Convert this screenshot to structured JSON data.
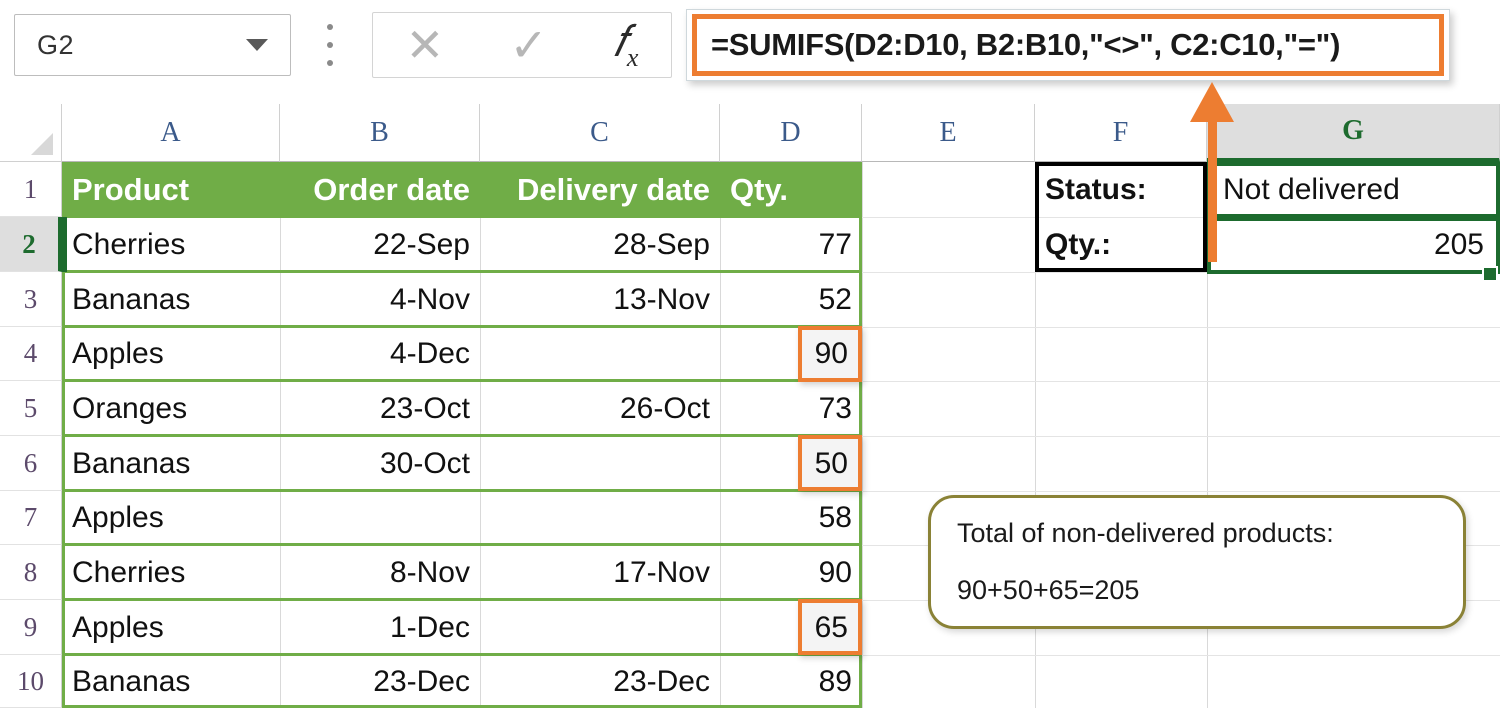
{
  "formula_bar": {
    "name_box_value": "G2",
    "name_box_chevron_icon": "chevron-down-icon",
    "cancel_icon": "close-x-icon",
    "confirm_icon": "check-icon",
    "function_icon": "fx-insert-function-icon",
    "more_icon": "vertical-dots-icon",
    "formula": "=SUMIFS(D2:D10, B2:B10,\"<>\", C2:C10,\"=\")",
    "highlight_color": "#ED7D31"
  },
  "grid": {
    "column_headers": [
      "A",
      "B",
      "C",
      "D",
      "E",
      "F",
      "G"
    ],
    "selected_column": "G",
    "row_headers": [
      "1",
      "2",
      "3",
      "4",
      "5",
      "6",
      "7",
      "8",
      "9",
      "10"
    ],
    "selected_row": "2",
    "table_header": {
      "fill_color": "#70AD47",
      "text_color": "#FFFFFF",
      "cells": [
        "Product",
        "Order date",
        "Delivery date",
        "Qty."
      ]
    },
    "rows": [
      {
        "row": "2",
        "product": "Cherries",
        "order_date": "22-Sep",
        "delivery_date": "28-Sep",
        "qty": "77",
        "qty_highlighted": false
      },
      {
        "row": "3",
        "product": "Bananas",
        "order_date": "4-Nov",
        "delivery_date": "13-Nov",
        "qty": "52",
        "qty_highlighted": false
      },
      {
        "row": "4",
        "product": "Apples",
        "order_date": "4-Dec",
        "delivery_date": "",
        "qty": "90",
        "qty_highlighted": true
      },
      {
        "row": "5",
        "product": "Oranges",
        "order_date": "23-Oct",
        "delivery_date": "26-Oct",
        "qty": "73",
        "qty_highlighted": false
      },
      {
        "row": "6",
        "product": "Bananas",
        "order_date": "30-Oct",
        "delivery_date": "",
        "qty": "50",
        "qty_highlighted": true
      },
      {
        "row": "7",
        "product": "Apples",
        "order_date": "",
        "delivery_date": "",
        "qty": "58",
        "qty_highlighted": false
      },
      {
        "row": "8",
        "product": "Cherries",
        "order_date": "8-Nov",
        "delivery_date": "17-Nov",
        "qty": "90",
        "qty_highlighted": false
      },
      {
        "row": "9",
        "product": "Apples",
        "order_date": "1-Dec",
        "delivery_date": "",
        "qty": "65",
        "qty_highlighted": true
      },
      {
        "row": "10",
        "product": "Bananas",
        "order_date": "23-Dec",
        "delivery_date": "23-Dec",
        "qty": "89",
        "qty_highlighted": false
      }
    ],
    "criteria_panel": {
      "status_label": "Status:",
      "status_value": "Not delivered",
      "qty_label": "Qty.:",
      "qty_value": "205",
      "label_border_color": "#000000",
      "value_border_color": "#1D6B2E"
    }
  },
  "callout": {
    "line1": "Total of non-delivered products:",
    "line2": "90+50+65=205",
    "border_color": "#8A8236"
  },
  "annotation_arrow": {
    "icon": "up-arrow-annotation",
    "color": "#ED7D31"
  }
}
